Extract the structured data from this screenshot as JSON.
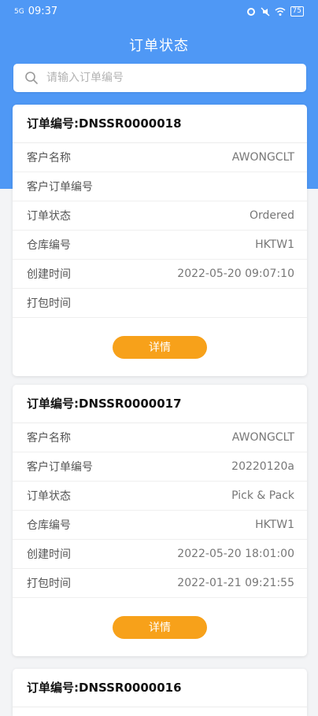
{
  "statusbar": {
    "time": "09:37",
    "signal_label": "5G",
    "battery": "75"
  },
  "header": {
    "title": "订单状态"
  },
  "search": {
    "placeholder": "请输入订单编号",
    "value": ""
  },
  "colors": {
    "brand": "#4f98f5",
    "accent": "#f7a11a"
  },
  "orders": [
    {
      "header": "订单编号:DNSSR0000018",
      "rows": [
        {
          "label": "客户名称",
          "value": "AWONGCLT"
        },
        {
          "label": "客户订单编号",
          "value": ""
        },
        {
          "label": "订单状态",
          "value": "Ordered"
        },
        {
          "label": "仓库编号",
          "value": "HKTW1"
        },
        {
          "label": "创建时间",
          "value": "2022-05-20 09:07:10"
        },
        {
          "label": "打包时间",
          "value": ""
        }
      ],
      "button": "详情"
    },
    {
      "header": "订单编号:DNSSR0000017",
      "rows": [
        {
          "label": "客户名称",
          "value": "AWONGCLT"
        },
        {
          "label": "客户订单编号",
          "value": "20220120a"
        },
        {
          "label": "订单状态",
          "value": "Pick & Pack"
        },
        {
          "label": "仓库编号",
          "value": "HKTW1"
        },
        {
          "label": "创建时间",
          "value": "2022-05-20 18:01:00"
        },
        {
          "label": "打包时间",
          "value": "2022-01-21 09:21:55"
        }
      ],
      "button": "详情"
    },
    {
      "header": "订单编号:DNSSR0000016"
    }
  ]
}
